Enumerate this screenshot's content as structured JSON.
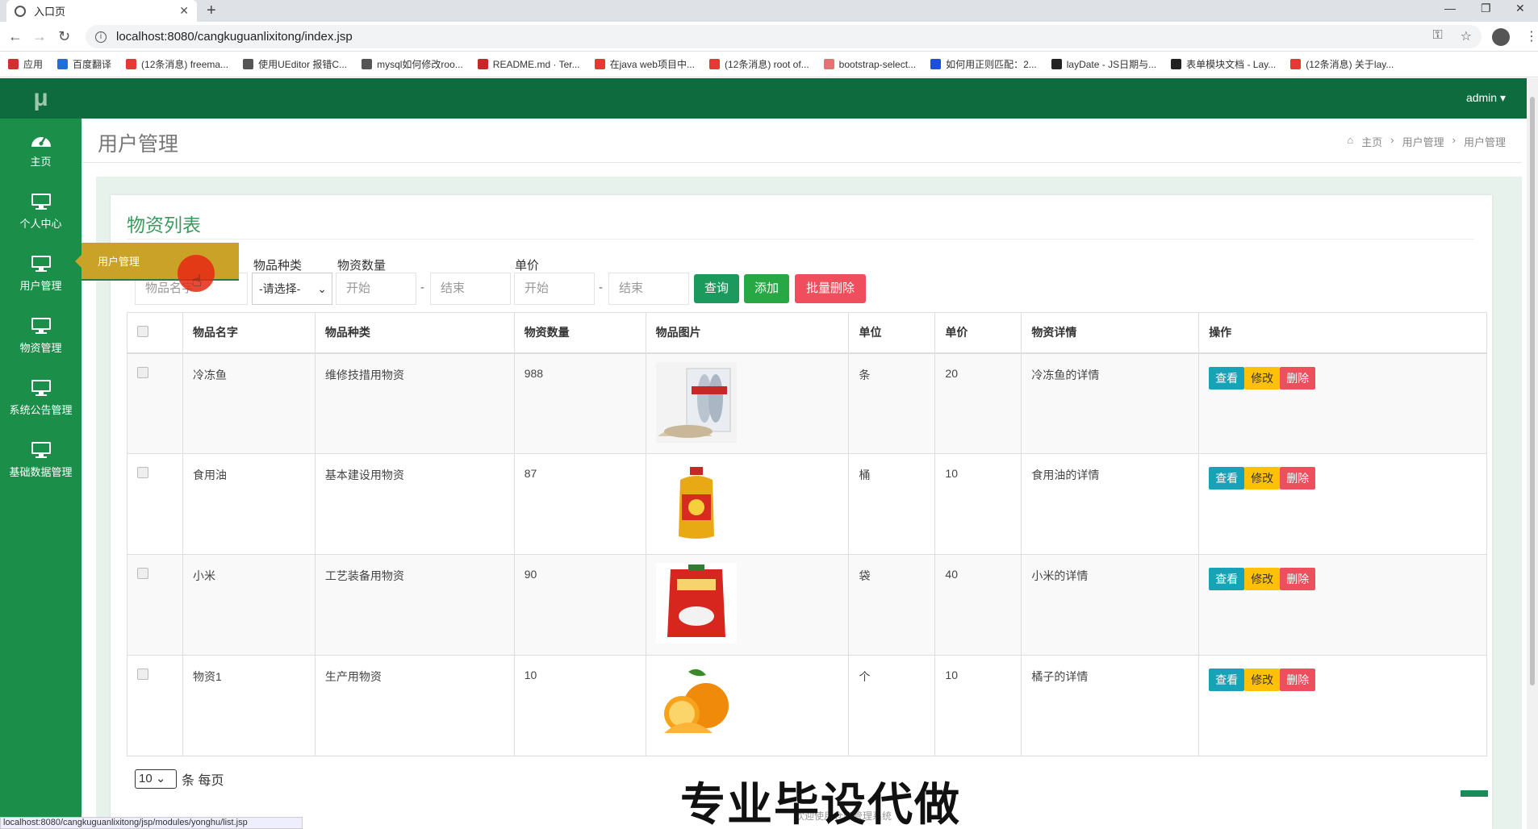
{
  "browser": {
    "tab_title": "入口页",
    "url": "localhost:8080/cangkuguanlixitong/index.jsp",
    "status_url": "localhost:8080/cangkuguanlixitong/jsp/modules/yonghu/list.jsp",
    "bookmarks": [
      {
        "label": "应用",
        "color": "#d32f2f"
      },
      {
        "label": "百度翻译",
        "color": "#1e6fd9"
      },
      {
        "label": "(12条消息) freema...",
        "color": "#e53935"
      },
      {
        "label": "使用UEditor 报错C...",
        "color": "#555555"
      },
      {
        "label": "mysql如何修改roo...",
        "color": "#555555"
      },
      {
        "label": "README.md · Ter...",
        "color": "#c62828"
      },
      {
        "label": "在java web项目中...",
        "color": "#e53935"
      },
      {
        "label": "(12条消息) root of...",
        "color": "#e53935"
      },
      {
        "label": "bootstrap-select...",
        "color": "#e57373"
      },
      {
        "label": "如何用正则匹配：2...",
        "color": "#1e4fd9"
      },
      {
        "label": "layDate - JS日期与...",
        "color": "#222222"
      },
      {
        "label": "表单模块文档 - Lay...",
        "color": "#222222"
      },
      {
        "label": "(12条消息) 关于lay...",
        "color": "#e53935"
      }
    ]
  },
  "app": {
    "logo": "μ",
    "admin_label": "admin ▾",
    "nav": [
      {
        "label": "主页",
        "icon": "dashboard-icon"
      },
      {
        "label": "个人中心",
        "icon": "monitor-icon"
      },
      {
        "label": "用户管理",
        "icon": "monitor-icon"
      },
      {
        "label": "物资管理",
        "icon": "monitor-icon"
      },
      {
        "label": "系统公告管理",
        "icon": "monitor-icon"
      },
      {
        "label": "基础数据管理",
        "icon": "monitor-icon"
      }
    ],
    "popup_label": "用户管理"
  },
  "header": {
    "title": "用户管理",
    "breadcrumb": [
      "主页",
      "用户管理",
      "用户管理"
    ]
  },
  "card": {
    "title": "物资列表"
  },
  "filters": {
    "name_placeholder": "物品名字",
    "category_label": "物品种类",
    "category_value": "-请选择-",
    "qty_label": "物资数量",
    "qty_start": "开始",
    "qty_end": "结束",
    "price_label": "单价",
    "price_start": "开始",
    "price_end": "结束",
    "search_btn": "查询",
    "add_btn": "添加",
    "batch_delete_btn": "批量删除"
  },
  "table": {
    "headers": [
      "物品名字",
      "物品种类",
      "物资数量",
      "物品图片",
      "单位",
      "单价",
      "物资详情",
      "操作"
    ],
    "rows": [
      {
        "name": "冷冻鱼",
        "category": "维修技措用物资",
        "qty": "988",
        "unit": "条",
        "price": "20",
        "detail": "冷冻鱼的详情",
        "image": "frozen-fish"
      },
      {
        "name": "食用油",
        "category": "基本建设用物资",
        "qty": "87",
        "unit": "桶",
        "price": "10",
        "detail": "食用油的详情",
        "image": "cooking-oil"
      },
      {
        "name": "小米",
        "category": "工艺装备用物资",
        "qty": "90",
        "unit": "袋",
        "price": "40",
        "detail": "小米的详情",
        "image": "rice-bag"
      },
      {
        "name": "物资1",
        "category": "生产用物资",
        "qty": "10",
        "unit": "个",
        "price": "10",
        "detail": "橘子的详情",
        "image": "oranges"
      }
    ],
    "actions": {
      "view": "查看",
      "edit": "修改",
      "delete": "删除"
    }
  },
  "pager": {
    "page_size": "10",
    "suffix": "条 每页"
  },
  "watermark": {
    "main": "专业毕设代做",
    "sub": "欢迎使用仓库管理系统"
  },
  "colors": {
    "sidebar": "#1b8e4a",
    "topbar": "#0d6b3d",
    "view_btn": "#17a2b8",
    "edit_btn": "#ffc107",
    "delete_btn": "#ef4e5c",
    "search_btn": "#1c9a5e",
    "add_btn": "#28a745",
    "batch_delete_btn": "#ef4e5c"
  }
}
